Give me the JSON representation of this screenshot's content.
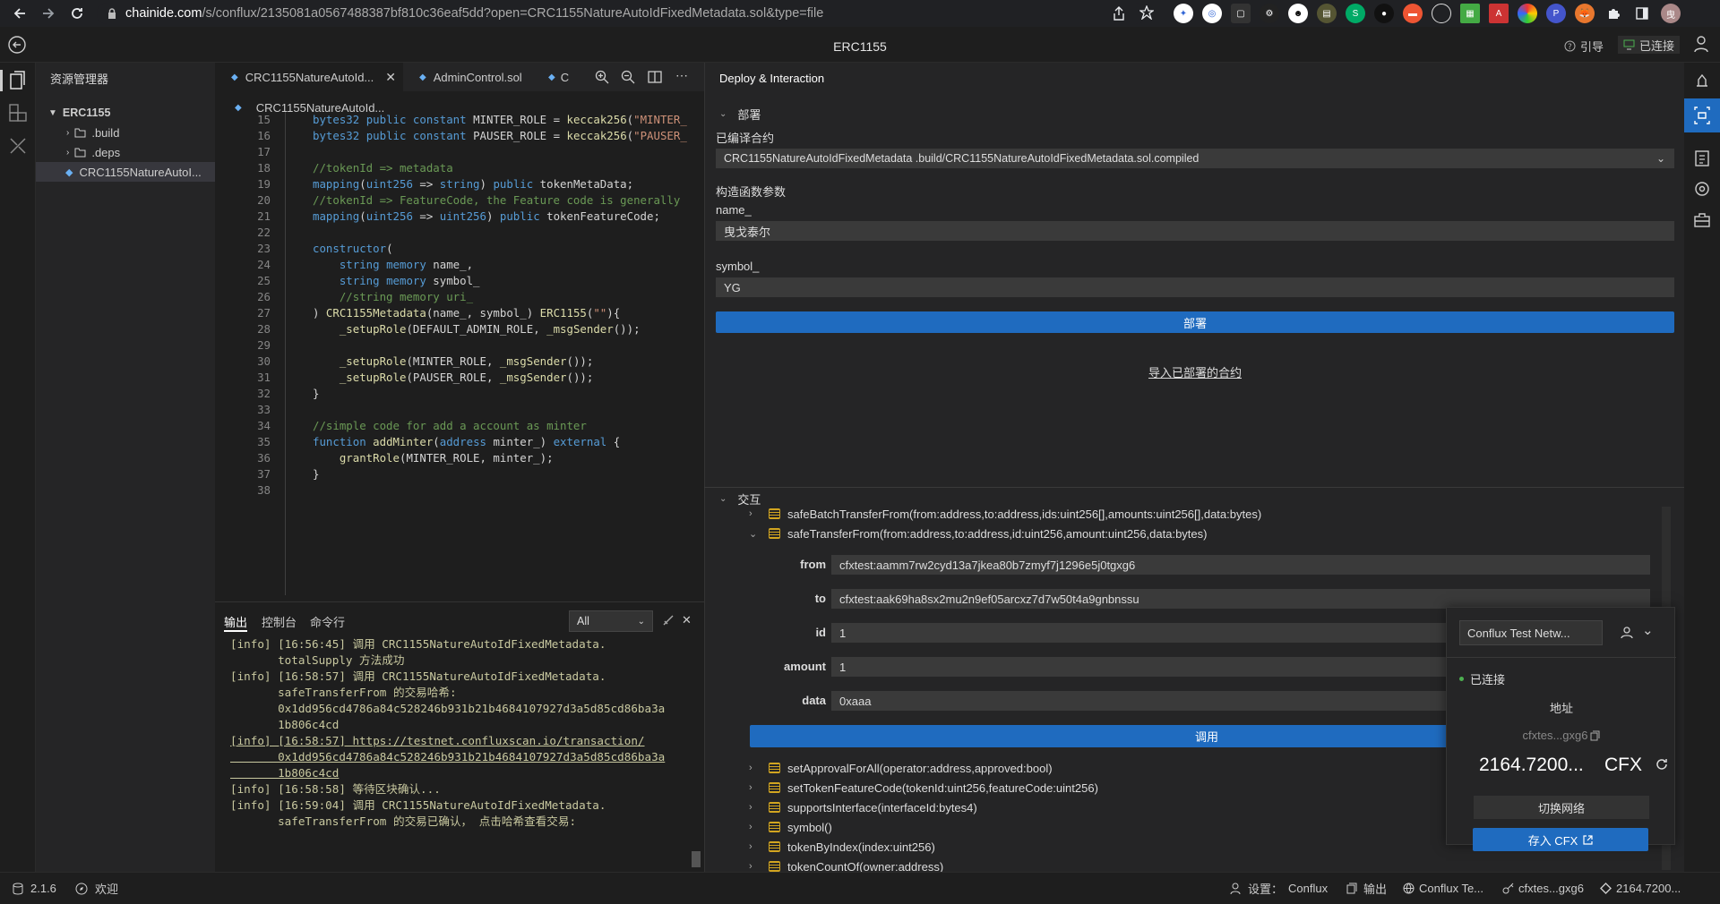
{
  "browser": {
    "url_host": "chainide.com",
    "url_path": "/s/conflux/2135081a0567488387bf810c36eaf5dd?open=CRC1155NatureAutoIdFixedMetadata.sol&type=file"
  },
  "app": {
    "title": "ERC1155",
    "guide_label": "引导",
    "connected_label": "已连接"
  },
  "explorer": {
    "title": "资源管理器",
    "root": "ERC1155",
    "items": [
      ".build",
      ".deps",
      "CRC1155NatureAutoI..."
    ]
  },
  "editor": {
    "tabs": [
      "CRC1155NatureAutoId...",
      "AdminControl.sol",
      "C"
    ],
    "breadcrumb": "CRC1155NatureAutoId...",
    "lines": [
      {
        "n": "15",
        "t": "bytes32 public constant MINTER_ROLE = keccak256(\"MINTER_"
      },
      {
        "n": "16",
        "t": "bytes32 public constant PAUSER_ROLE = keccak256(\"PAUSER_"
      },
      {
        "n": "17",
        "t": ""
      },
      {
        "n": "18",
        "t": "//tokenId => metadata"
      },
      {
        "n": "19",
        "t": "mapping(uint256 => string) public tokenMetaData;"
      },
      {
        "n": "20",
        "t": "//tokenId => FeatureCode, the Feature code is generally"
      },
      {
        "n": "21",
        "t": "mapping(uint256 => uint256) public tokenFeatureCode;"
      },
      {
        "n": "22",
        "t": ""
      },
      {
        "n": "23",
        "t": "constructor("
      },
      {
        "n": "24",
        "t": "    string memory name_,"
      },
      {
        "n": "25",
        "t": "    string memory symbol_"
      },
      {
        "n": "26",
        "t": "    //string memory uri_"
      },
      {
        "n": "27",
        "t": ") CRC1155Metadata(name_, symbol_) ERC1155(\"\"){"
      },
      {
        "n": "28",
        "t": "    _setupRole(DEFAULT_ADMIN_ROLE, _msgSender());"
      },
      {
        "n": "29",
        "t": ""
      },
      {
        "n": "30",
        "t": "    _setupRole(MINTER_ROLE, _msgSender());"
      },
      {
        "n": "31",
        "t": "    _setupRole(PAUSER_ROLE, _msgSender());"
      },
      {
        "n": "32",
        "t": "}"
      },
      {
        "n": "33",
        "t": ""
      },
      {
        "n": "34",
        "t": "//simple code for add a account as minter"
      },
      {
        "n": "35",
        "t": "function addMinter(address minter_) external {"
      },
      {
        "n": "36",
        "t": "    grantRole(MINTER_ROLE, minter_);"
      },
      {
        "n": "37",
        "t": "}"
      },
      {
        "n": "38",
        "t": ""
      }
    ]
  },
  "output": {
    "tabs": [
      "输出",
      "控制台",
      "命令行"
    ],
    "filter": "All",
    "lines": [
      "[info] [16:56:45] 调用 CRC1155NatureAutoIdFixedMetadata.",
      "       totalSupply 方法成功",
      "[info] [16:58:57] 调用 CRC1155NatureAutoIdFixedMetadata.",
      "       safeTransferFrom 的交易哈希:",
      "       0x1dd956cd4786a84c528246b931b21b4684107927d3a5d85cd86ba3a",
      "       1b806c4cd",
      "[info] [16:58:57] https://testnet.confluxscan.io/transaction/",
      "       0x1dd956cd4786a84c528246b931b21b4684107927d3a5d85cd86ba3a",
      "       1b806c4cd",
      "[info] [16:58:58] 等待区块确认...",
      "[info] [16:59:04] 调用 CRC1155NatureAutoIdFixedMetadata.",
      "       safeTransferFrom 的交易已确认， 点击哈希查看交易:"
    ]
  },
  "deploy": {
    "header": "Deploy & Interaction",
    "section_deploy": "部署",
    "compiled_label": "已编译合约",
    "compiled_value": "CRC1155NatureAutoIdFixedMetadata .build/CRC1155NatureAutoIdFixedMetadata.sol.compiled",
    "ctor_label": "构造函数参数",
    "name_label": "name_",
    "name_value": "曳戈泰尔",
    "symbol_label": "symbol_",
    "symbol_value": "YG",
    "deploy_button": "部署",
    "import_link": "导入已部署的合约",
    "section_interact": "交互",
    "functions_top": [
      "safeBatchTransferFrom(from:address,to:address,ids:uint256[],amounts:uint256[],data:bytes)",
      "safeTransferFrom(from:address,to:address,id:uint256,amount:uint256,data:bytes)"
    ],
    "params": [
      {
        "label": "from",
        "value": "cfxtest:aamm7rw2cyd13a7jkea80b7zmyf7j1296e5j0tgxg6"
      },
      {
        "label": "to",
        "value": "cfxtest:aak69ha8sx2mu2n9ef05arcxz7d7w50t4a9gnbnssu"
      },
      {
        "label": "id",
        "value": "1"
      },
      {
        "label": "amount",
        "value": "1"
      },
      {
        "label": "data",
        "value": "0xaaa"
      }
    ],
    "invoke_button": "调用",
    "functions_bottom": [
      "setApprovalForAll(operator:address,approved:bool)",
      "setTokenFeatureCode(tokenId:uint256,featureCode:uint256)",
      "supportsInterface(interfaceId:bytes4)",
      "symbol()",
      "tokenByIndex(index:uint256)",
      "tokenCountOf(owner:address)"
    ]
  },
  "wallet": {
    "network": "Conflux Test Netw...",
    "status": "已连接",
    "address_label": "地址",
    "address": "cfxtes...gxg6",
    "balance": "2164.7200...",
    "unit": "CFX",
    "switch_button": "切换网络",
    "deposit_button": "存入 CFX"
  },
  "statusbar": {
    "version": "2.1.6",
    "welcome": "欢迎",
    "settings": "设置：",
    "settings_value": "Conflux",
    "output": "输出",
    "network": "Conflux Te...",
    "account": "cfxtes...gxg6",
    "balance": "2164.7200..."
  },
  "colors": {
    "accent": "#1f6bbf",
    "connected": "#4caf50",
    "link": "#e5c07b"
  }
}
